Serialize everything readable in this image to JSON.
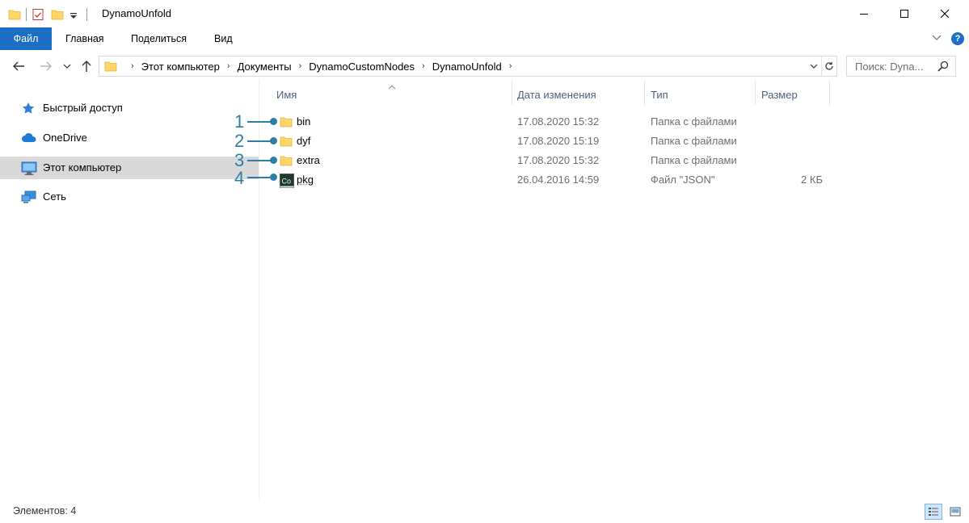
{
  "window": {
    "title": "DynamoUnfold"
  },
  "ribbon": {
    "tabs": [
      "Файл",
      "Главная",
      "Поделиться",
      "Вид"
    ],
    "help": "?"
  },
  "address": {
    "crumbs": [
      "Этот компьютер",
      "Документы",
      "DynamoCustomNodes",
      "DynamoUnfold"
    ],
    "search_placeholder": "Поиск: Dyna..."
  },
  "navpane": {
    "items": [
      {
        "label": "Быстрый доступ",
        "icon": "star-icon",
        "selected": false
      },
      {
        "label": "OneDrive",
        "icon": "cloud-icon",
        "selected": false
      },
      {
        "label": "Этот компьютер",
        "icon": "computer-icon",
        "selected": true
      },
      {
        "label": "Сеть",
        "icon": "network-icon",
        "selected": false
      }
    ]
  },
  "columns": {
    "name": "Имя",
    "date": "Дата изменения",
    "type": "Тип",
    "size": "Размер"
  },
  "files": [
    {
      "name": "bin",
      "date": "17.08.2020 15:32",
      "type": "Папка с файлами",
      "size": "",
      "icon": "folder-icon",
      "callout": "1"
    },
    {
      "name": "dyf",
      "date": "17.08.2020 15:19",
      "type": "Папка с файлами",
      "size": "",
      "icon": "folder-icon",
      "callout": "2"
    },
    {
      "name": "extra",
      "date": "17.08.2020 15:32",
      "type": "Папка с файлами",
      "size": "",
      "icon": "folder-icon",
      "callout": "3"
    },
    {
      "name": "pkg",
      "date": "26.04.2016 14:59",
      "type": "Файл \"JSON\"",
      "size": "2 КБ",
      "icon": "json-file-icon",
      "callout": "4"
    }
  ],
  "json_icon_text": "Co",
  "status": {
    "items_count": "Элементов: 4"
  },
  "colors": {
    "accent": "#1a6fc4",
    "callout": "#2a7ea8",
    "folder": "#ffd767",
    "selected": "#d9d9d9"
  }
}
